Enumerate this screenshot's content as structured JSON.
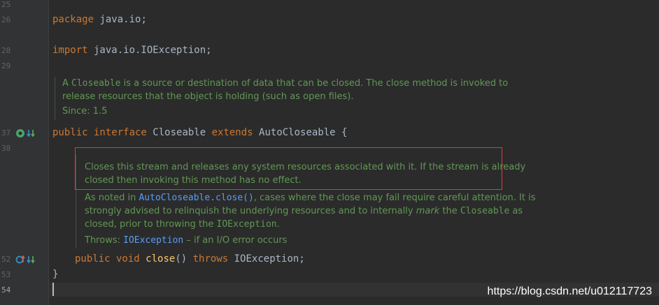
{
  "gutter": {
    "line_numbers": [
      "25",
      "26",
      "28",
      "29",
      "37",
      "38",
      "52",
      "53",
      "54"
    ]
  },
  "code": {
    "package_kw": "package",
    "package_name": " java.io;",
    "import_kw": "import",
    "import_name": " java.io.IOException;",
    "interface_public": "public",
    "interface_kw": " interface",
    "interface_name": " Closeable ",
    "extends_kw": "extends",
    "extends_name": " AutoCloseable {",
    "method_public": "public",
    "method_void": " void",
    "method_name": " close",
    "method_params": "() ",
    "method_throws": "throws",
    "method_exception": " IOException;",
    "close_brace": "}"
  },
  "class_doc": {
    "part1": "A ",
    "closeable": "Closeable",
    "part2": " is a source or destination of data that can be closed. The close method is invoked to",
    "line2": "release resources that the object is holding (such as open files).",
    "since": "Since: 1.5"
  },
  "method_doc": {
    "line1": "Closes this stream and releases any system resources associated with it. If the stream is already",
    "line2": "closed then invoking this method has no effect.",
    "p2_a": "As noted in ",
    "p2_link": "AutoCloseable.close()",
    "p2_b": ", cases where the close may fail require careful attention. It is",
    "p2_line2_a": "strongly advised to relinquish the underlying resources and to internally ",
    "p2_mark": "mark",
    "p2_line2_b": " the ",
    "p2_closeable": "Closeable",
    "p2_line2_c": " as",
    "p2_line3_a": "closed, prior to throwing the ",
    "p2_ioexception": "IOException",
    "p2_line3_b": ".",
    "throws_label": "Throws: ",
    "throws_link": "IOException",
    "throws_desc": " – if an I/O error occurs"
  },
  "watermark": "https://blog.csdn.net/u012117723",
  "colors": {
    "background": "#2b2b2b",
    "keyword": "#cc7832",
    "doc_text": "#629755",
    "link": "#589df6",
    "highlight_border": "#e03a3a"
  },
  "icons": [
    "implementation-icon",
    "override-down-icon",
    "overriding-up-icon"
  ]
}
